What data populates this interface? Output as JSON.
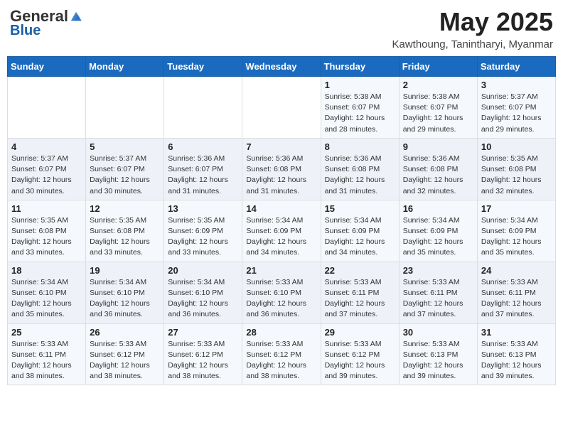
{
  "logo": {
    "general": "General",
    "blue": "Blue"
  },
  "header": {
    "title": "May 2025",
    "subtitle": "Kawthoung, Tanintharyi, Myanmar"
  },
  "weekdays": [
    "Sunday",
    "Monday",
    "Tuesday",
    "Wednesday",
    "Thursday",
    "Friday",
    "Saturday"
  ],
  "weeks": [
    [
      {
        "day": "",
        "info": ""
      },
      {
        "day": "",
        "info": ""
      },
      {
        "day": "",
        "info": ""
      },
      {
        "day": "",
        "info": ""
      },
      {
        "day": "1",
        "info": "Sunrise: 5:38 AM\nSunset: 6:07 PM\nDaylight: 12 hours\nand 28 minutes."
      },
      {
        "day": "2",
        "info": "Sunrise: 5:38 AM\nSunset: 6:07 PM\nDaylight: 12 hours\nand 29 minutes."
      },
      {
        "day": "3",
        "info": "Sunrise: 5:37 AM\nSunset: 6:07 PM\nDaylight: 12 hours\nand 29 minutes."
      }
    ],
    [
      {
        "day": "4",
        "info": "Sunrise: 5:37 AM\nSunset: 6:07 PM\nDaylight: 12 hours\nand 30 minutes."
      },
      {
        "day": "5",
        "info": "Sunrise: 5:37 AM\nSunset: 6:07 PM\nDaylight: 12 hours\nand 30 minutes."
      },
      {
        "day": "6",
        "info": "Sunrise: 5:36 AM\nSunset: 6:07 PM\nDaylight: 12 hours\nand 31 minutes."
      },
      {
        "day": "7",
        "info": "Sunrise: 5:36 AM\nSunset: 6:08 PM\nDaylight: 12 hours\nand 31 minutes."
      },
      {
        "day": "8",
        "info": "Sunrise: 5:36 AM\nSunset: 6:08 PM\nDaylight: 12 hours\nand 31 minutes."
      },
      {
        "day": "9",
        "info": "Sunrise: 5:36 AM\nSunset: 6:08 PM\nDaylight: 12 hours\nand 32 minutes."
      },
      {
        "day": "10",
        "info": "Sunrise: 5:35 AM\nSunset: 6:08 PM\nDaylight: 12 hours\nand 32 minutes."
      }
    ],
    [
      {
        "day": "11",
        "info": "Sunrise: 5:35 AM\nSunset: 6:08 PM\nDaylight: 12 hours\nand 33 minutes."
      },
      {
        "day": "12",
        "info": "Sunrise: 5:35 AM\nSunset: 6:08 PM\nDaylight: 12 hours\nand 33 minutes."
      },
      {
        "day": "13",
        "info": "Sunrise: 5:35 AM\nSunset: 6:09 PM\nDaylight: 12 hours\nand 33 minutes."
      },
      {
        "day": "14",
        "info": "Sunrise: 5:34 AM\nSunset: 6:09 PM\nDaylight: 12 hours\nand 34 minutes."
      },
      {
        "day": "15",
        "info": "Sunrise: 5:34 AM\nSunset: 6:09 PM\nDaylight: 12 hours\nand 34 minutes."
      },
      {
        "day": "16",
        "info": "Sunrise: 5:34 AM\nSunset: 6:09 PM\nDaylight: 12 hours\nand 35 minutes."
      },
      {
        "day": "17",
        "info": "Sunrise: 5:34 AM\nSunset: 6:09 PM\nDaylight: 12 hours\nand 35 minutes."
      }
    ],
    [
      {
        "day": "18",
        "info": "Sunrise: 5:34 AM\nSunset: 6:10 PM\nDaylight: 12 hours\nand 35 minutes."
      },
      {
        "day": "19",
        "info": "Sunrise: 5:34 AM\nSunset: 6:10 PM\nDaylight: 12 hours\nand 36 minutes."
      },
      {
        "day": "20",
        "info": "Sunrise: 5:34 AM\nSunset: 6:10 PM\nDaylight: 12 hours\nand 36 minutes."
      },
      {
        "day": "21",
        "info": "Sunrise: 5:33 AM\nSunset: 6:10 PM\nDaylight: 12 hours\nand 36 minutes."
      },
      {
        "day": "22",
        "info": "Sunrise: 5:33 AM\nSunset: 6:11 PM\nDaylight: 12 hours\nand 37 minutes."
      },
      {
        "day": "23",
        "info": "Sunrise: 5:33 AM\nSunset: 6:11 PM\nDaylight: 12 hours\nand 37 minutes."
      },
      {
        "day": "24",
        "info": "Sunrise: 5:33 AM\nSunset: 6:11 PM\nDaylight: 12 hours\nand 37 minutes."
      }
    ],
    [
      {
        "day": "25",
        "info": "Sunrise: 5:33 AM\nSunset: 6:11 PM\nDaylight: 12 hours\nand 38 minutes."
      },
      {
        "day": "26",
        "info": "Sunrise: 5:33 AM\nSunset: 6:12 PM\nDaylight: 12 hours\nand 38 minutes."
      },
      {
        "day": "27",
        "info": "Sunrise: 5:33 AM\nSunset: 6:12 PM\nDaylight: 12 hours\nand 38 minutes."
      },
      {
        "day": "28",
        "info": "Sunrise: 5:33 AM\nSunset: 6:12 PM\nDaylight: 12 hours\nand 38 minutes."
      },
      {
        "day": "29",
        "info": "Sunrise: 5:33 AM\nSunset: 6:12 PM\nDaylight: 12 hours\nand 39 minutes."
      },
      {
        "day": "30",
        "info": "Sunrise: 5:33 AM\nSunset: 6:13 PM\nDaylight: 12 hours\nand 39 minutes."
      },
      {
        "day": "31",
        "info": "Sunrise: 5:33 AM\nSunset: 6:13 PM\nDaylight: 12 hours\nand 39 minutes."
      }
    ]
  ]
}
